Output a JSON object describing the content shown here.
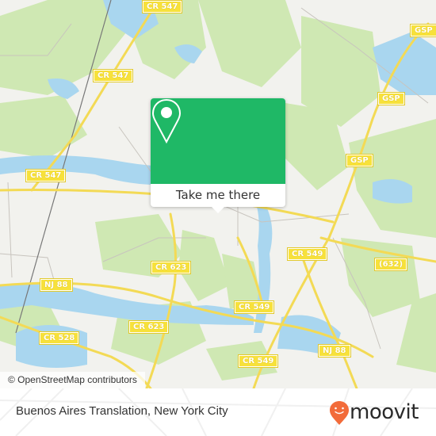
{
  "map": {
    "colors": {
      "land": "#f2f2ee",
      "forest": "#cfe8b3",
      "water": "#a9d6ef",
      "road_major": "#f3da55",
      "road_minor": "#c8c4be",
      "rail": "#777777",
      "shield_bg": "#f7e13b"
    },
    "road_labels": [
      {
        "id": "cr547-top",
        "text": "CR 547"
      },
      {
        "id": "cr547-mid",
        "text": "CR 547"
      },
      {
        "id": "cr547-low",
        "text": "CR 547"
      },
      {
        "id": "gsp-top",
        "text": "GSP"
      },
      {
        "id": "gsp-mid",
        "text": "GSP"
      },
      {
        "id": "gsp-low",
        "text": "GSP"
      },
      {
        "id": "cr623-upper",
        "text": "CR 623"
      },
      {
        "id": "cr623-lower",
        "text": "CR 623"
      },
      {
        "id": "nj88-left",
        "text": "NJ 88"
      },
      {
        "id": "nj88-right",
        "text": "NJ 88"
      },
      {
        "id": "cr528",
        "text": "CR 528"
      },
      {
        "id": "cr549-upper",
        "text": "CR 549"
      },
      {
        "id": "cr549-mid",
        "text": "CR 549"
      },
      {
        "id": "cr549-low",
        "text": "CR 549"
      },
      {
        "id": "r632",
        "text": "(632)"
      }
    ],
    "attribution": "© OpenStreetMap contributors"
  },
  "popup": {
    "icon": "map-pin-icon",
    "color": "#1fb866",
    "button_label": "Take me there"
  },
  "footer": {
    "place_name": "Buenos Aires Translation, New York City",
    "logo_text": "moovit",
    "logo_icon": "moovit-pin-icon",
    "logo_color": "#f26b3a"
  }
}
